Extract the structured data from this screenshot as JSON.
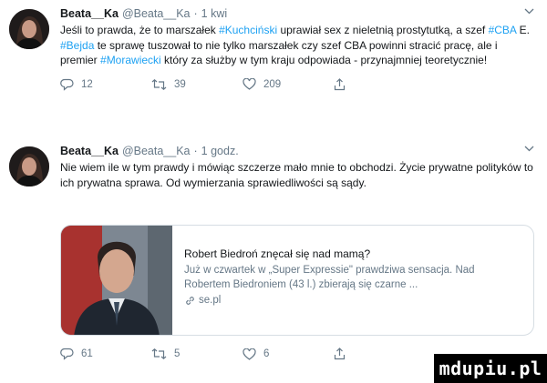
{
  "tweets": [
    {
      "user": "Beata__Ka",
      "handle": "@Beata__Ka",
      "separator": "·",
      "time": "1 kwi",
      "text_parts": [
        "Jeśli to prawda, że to marszałek ",
        "#Kuchciński",
        " uprawiał sex z nieletnią prostytutką, a szef ",
        "#CBA",
        " E. ",
        "#Bejda",
        " te sprawę tuszował to nie tylko marszałek czy szef CBA powinni stracić pracę, ale  i premier ",
        "#Morawiecki",
        " który za służby w tym kraju odpowiada - przynajmniej teoretycznie!"
      ],
      "replies": "12",
      "retweets": "39",
      "likes": "209"
    },
    {
      "user": "Beata__Ka",
      "handle": "@Beata__Ka",
      "separator": "·",
      "time": "1 godz.",
      "text": "Nie wiem ile w tym prawdy i mówiąc szczerze mało mnie to obchodzi. Życie prywatne polityków to ich prywatna sprawa. Od wymierzania sprawiedliwości są sądy.",
      "card": {
        "title": "Robert Biedroń znęcał się nad mamą?",
        "description": "Już w czwartek w „Super Expressie\" prawdziwa sensacja. Nad Robertem Biedroniem (43 l.) zbierają się czarne ...",
        "domain": "se.pl"
      },
      "replies": "61",
      "retweets": "5",
      "likes": "6"
    }
  ],
  "watermark": "mdupiu.pl",
  "colors": {
    "link": "#1da1f2",
    "muted": "#657786",
    "text": "#14171a",
    "border": "#d6dde3"
  },
  "icons": [
    "reply-icon",
    "retweet-icon",
    "like-icon",
    "share-icon",
    "chevron-down-icon",
    "link-icon"
  ]
}
